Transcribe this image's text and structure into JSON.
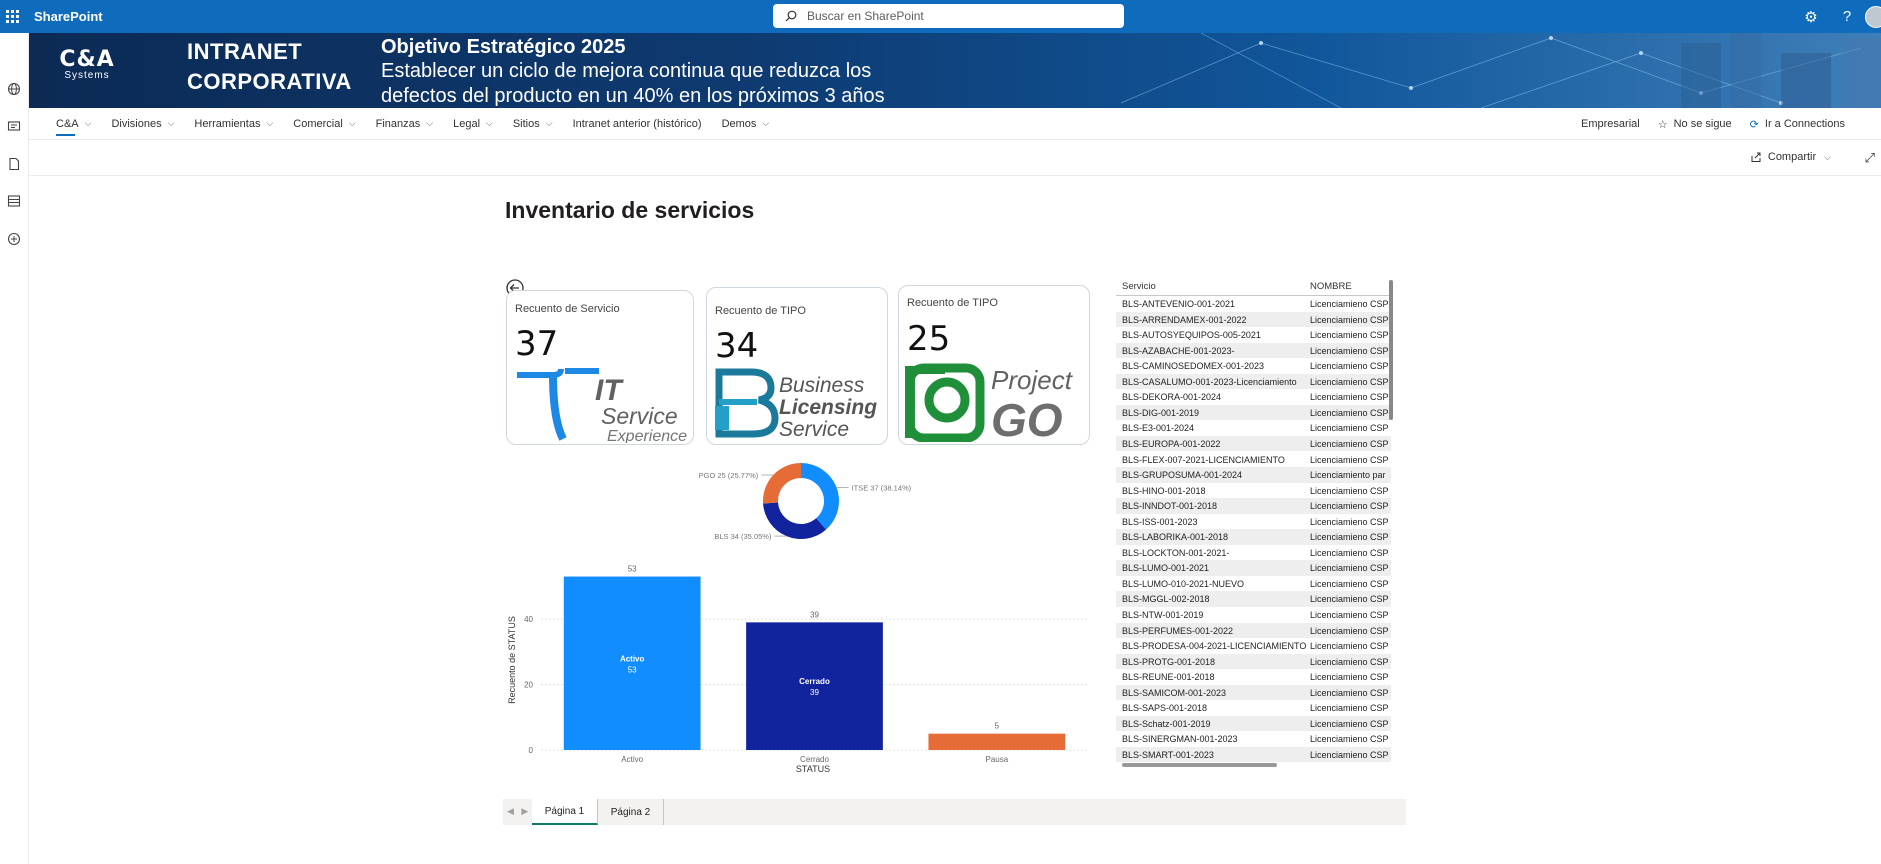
{
  "suite": {
    "app_name": "SharePoint",
    "search_placeholder": "Buscar en SharePoint"
  },
  "banner": {
    "logo_main": "C&A",
    "logo_sub": "Systems",
    "intranet_line1": "INTRANET",
    "intranet_line2": "CORPORATIVA",
    "objective_title": "Objetivo Estratégico 2025",
    "objective_line1": "Establecer un ciclo de mejora continua que reduzca los",
    "objective_line2": "defectos del producto en un 40% en los próximos 3 años"
  },
  "nav": {
    "items": [
      {
        "label": "C&A"
      },
      {
        "label": "Divisiones"
      },
      {
        "label": "Herramientas"
      },
      {
        "label": "Comercial"
      },
      {
        "label": "Finanzas"
      },
      {
        "label": "Legal"
      },
      {
        "label": "Sitios"
      },
      {
        "label": "Intranet anterior (histórico)"
      },
      {
        "label": "Demos"
      }
    ],
    "right": {
      "empresarial": "Empresarial",
      "follow": "No se sigue",
      "connections": "Ir a Connections"
    }
  },
  "command": {
    "share": "Compartir"
  },
  "page": {
    "title": "Inventario de servicios"
  },
  "cards": [
    {
      "label": "Recuento de Servicio",
      "value": "37",
      "logo_line1": "IT",
      "logo_line2": "Service",
      "logo_line3": "Experience"
    },
    {
      "label": "Recuento de TIPO",
      "value": "34",
      "logo_line1": "Business",
      "logo_line2": "Licensing",
      "logo_line3": "Service"
    },
    {
      "label": "Recuento de TIPO",
      "value": "25",
      "logo_line1": "Project",
      "logo_line2": "GO"
    }
  ],
  "chart_data": [
    {
      "type": "pie",
      "variant": "donut",
      "categories": [
        "ITSE",
        "BLS",
        "PGO"
      ],
      "values": [
        37,
        34,
        25
      ],
      "percent_labels": [
        "ITSE 37 (38.14%)",
        "BLS 34 (35.05%)",
        "PGO 25 (25.77%)"
      ],
      "colors": [
        "#118dff",
        "#12239e",
        "#e66c37"
      ]
    },
    {
      "type": "bar",
      "categories": [
        "Activo",
        "Cerrado",
        "Pausa"
      ],
      "values": [
        53,
        39,
        5
      ],
      "colors": [
        "#118dff",
        "#12239e",
        "#e66c37"
      ],
      "xlabel": "STATUS",
      "ylabel": "Recuento de STATUS",
      "yticks": [
        0,
        20,
        40
      ],
      "ylim": [
        0,
        55
      ],
      "grid": true
    }
  ],
  "table": {
    "headers": [
      "Servicio",
      "NOMBRE"
    ],
    "rows": [
      [
        "BLS-ANTEVENIO-001-2021",
        "Licenciamieno CSP"
      ],
      [
        "BLS-ARRENDAMEX-001-2022",
        "Licenciamieno CSP"
      ],
      [
        "BLS-AUTOSYEQUIPOS-005-2021",
        "Licenciamieno CSP"
      ],
      [
        "BLS-AZABACHE-001-2023-",
        "Licenciamieno CSP"
      ],
      [
        "BLS-CAMINOSEDOMEX-001-2023",
        "Licenciamieno CSP"
      ],
      [
        "BLS-CASALUMO-001-2023-Licenciamiento",
        "Licenciamieno CSP"
      ],
      [
        "BLS-DEKORA-001-2024",
        "Licenciamieno CSP"
      ],
      [
        "BLS-DIG-001-2019",
        "Licenciamieno CSP"
      ],
      [
        "BLS-E3-001-2024",
        "Licenciamieno CSP"
      ],
      [
        "BLS-EUROPA-001-2022",
        "Licenciamieno CSP"
      ],
      [
        "BLS-FLEX-007-2021-LICENCIAMIENTO",
        "Licenciamieno CSP"
      ],
      [
        "BLS-GRUPOSUMA-001-2024",
        "Licenciamiento par"
      ],
      [
        "BLS-HINO-001-2018",
        "Licenciamieno CSP"
      ],
      [
        "BLS-INNDOT-001-2018",
        "Licenciamieno CSP"
      ],
      [
        "BLS-ISS-001-2023",
        "Licenciamieno CSP"
      ],
      [
        "BLS-LABORIKA-001-2018",
        "Licenciamieno CSP"
      ],
      [
        "BLS-LOCKTON-001-2021-",
        "Licenciamieno CSP"
      ],
      [
        "BLS-LUMO-001-2021",
        "Licenciamieno CSP"
      ],
      [
        "BLS-LUMO-010-2021-NUEVO",
        "Licenciamieno CSP"
      ],
      [
        "BLS-MGGL-002-2018",
        "Licenciamieno CSP"
      ],
      [
        "BLS-NTW-001-2019",
        "Licenciamieno CSP"
      ],
      [
        "BLS-PERFUMES-001-2022",
        "Licenciamieno CSP"
      ],
      [
        "BLS-PRODESA-004-2021-LICENCIAMIENTO",
        "Licenciamieno CSP"
      ],
      [
        "BLS-PROTG-001-2018",
        "Licenciamieno CSP"
      ],
      [
        "BLS-REUNE-001-2018",
        "Licenciamieno CSP"
      ],
      [
        "BLS-SAMICOM-001-2023",
        "Licenciamieno CSP"
      ],
      [
        "BLS-SAPS-001-2018",
        "Licenciamieno CSP"
      ],
      [
        "BLS-Schatz-001-2019",
        "Licenciamieno CSP"
      ],
      [
        "BLS-SINERGMAN-001-2023",
        "Licenciamieno CSP"
      ],
      [
        "BLS-SMART-001-2023",
        "Licenciamieno CSP"
      ]
    ]
  },
  "report_tabs": [
    "Página 1",
    "Página 2"
  ],
  "colors": {
    "suite": "#0f6cbd",
    "accent": "#0f6cbd",
    "tab_active": "#117865"
  }
}
